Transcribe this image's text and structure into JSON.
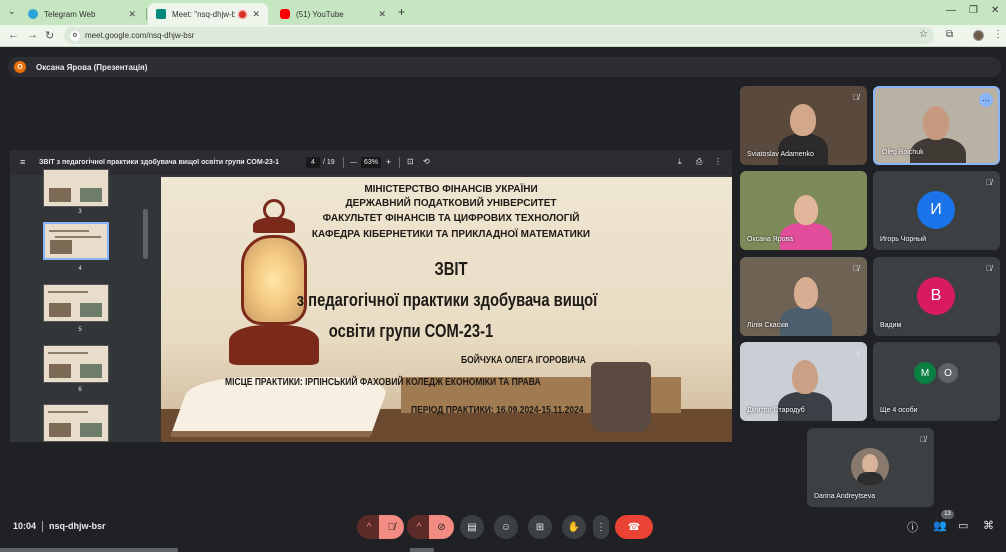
{
  "browser": {
    "tabs": [
      {
        "label": "Telegram Web",
        "color": "#2aa3d8"
      },
      {
        "label": "Meet: \"nsq-dhjw-bsr\"",
        "color": "#00897b"
      },
      {
        "label": "(51) YouTube",
        "color": "#ff0000"
      }
    ],
    "url": "meet.google.com/nsq-dhjw-bsr"
  },
  "meeting": {
    "presenter": "Оксана Ярова (Презентація)",
    "presenter_initial": "О",
    "time": "10:04",
    "code": "nsq-dhjw-bsr",
    "participants_count": "13"
  },
  "viewer": {
    "title": "ЗВІТ з педагогічної практики здобувача вищої освіти групи СОМ-23-1",
    "page": "4",
    "page_total": "/ 19",
    "zoom": "63%",
    "thumbnails": [
      {
        "num": "3"
      },
      {
        "num": "4"
      },
      {
        "num": "5"
      },
      {
        "num": "6"
      },
      {
        "num": ""
      }
    ]
  },
  "slide": {
    "line1": "МІНІСТЕРСТВО ФІНАНСІВ УКРАЇНИ",
    "line2": "ДЕРЖАВНИЙ ПОДАТКОВИЙ УНІВЕРСИТЕТ",
    "line3": "ФАКУЛЬТЕТ ФІНАНСІВ ТА ЦИФРОВИХ ТЕХНОЛОГІЙ",
    "line4": "КАФЕДРА КІБЕРНЕТИКИ ТА ПРИКЛАДНОЇ МАТЕМАТИКИ",
    "title1": "ЗВІТ",
    "title2": "з педагогічної практики здобувача вищої",
    "title3": "освіти групи СОМ-23-1",
    "author": "БОЙЧУКА ОЛЕГА ІГОРОВИЧА",
    "place": "МІСЦЕ ПРАКТИКИ: ІРПІНСЬКИЙ ФАХОВИЙ КОЛЕДЖ ЕКОНОМІКИ ТА ПРАВА",
    "period": "ПЕРІОД ПРАКТИКИ: 16.09.2024-15.11.2024"
  },
  "participants": [
    {
      "name": "Sviatoslav Adamenko"
    },
    {
      "name": "Oleg Boichuk"
    },
    {
      "name": "Оксана Ярова"
    },
    {
      "name": "Игорь Чорный",
      "initial": "И",
      "color": "#1a73e8"
    },
    {
      "name": "Лілія Скасків"
    },
    {
      "name": "Вадим",
      "initial": "В",
      "color": "#d81b60"
    },
    {
      "name": "Дмитро Стародуб"
    },
    {
      "name": "Ще 4 особи",
      "initials": [
        "М",
        "О"
      ],
      "colors": [
        "#0b8043",
        "#5f6368"
      ]
    },
    {
      "name": "Darina Andreytseva"
    }
  ]
}
